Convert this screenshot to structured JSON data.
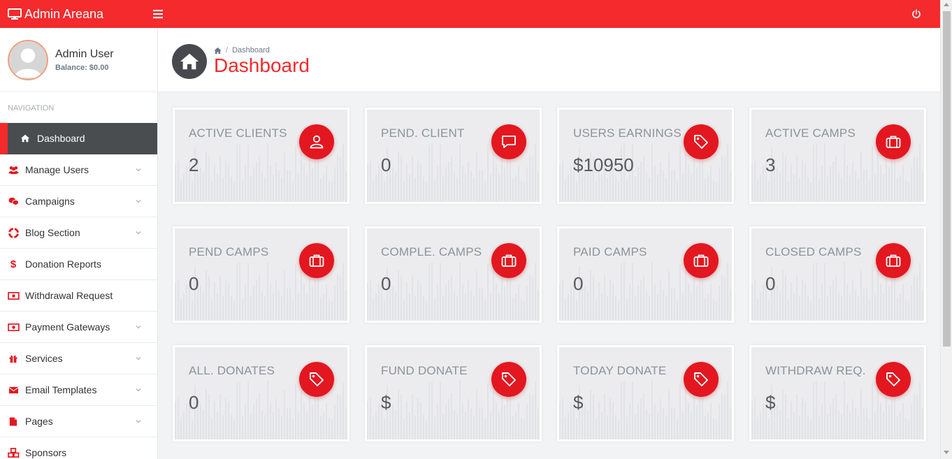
{
  "brand": {
    "title": "Admin Areana"
  },
  "user": {
    "name": "Admin User",
    "balance_label": "Balance:",
    "balance_value": "$0.00"
  },
  "sidebar": {
    "heading": "NAVIGATION",
    "items": [
      {
        "label": "Dashboard",
        "icon": "home-icon",
        "active": true,
        "has_chevron": false
      },
      {
        "label": "Manage Users",
        "icon": "users-icon",
        "has_chevron": true
      },
      {
        "label": "Campaigns",
        "icon": "campaigns-icon",
        "has_chevron": true
      },
      {
        "label": "Blog Section",
        "icon": "lifebuoy-icon",
        "has_chevron": true
      },
      {
        "label": "Donation Reports",
        "icon": "dollar-icon",
        "has_chevron": false
      },
      {
        "label": "Withdrawal Request",
        "icon": "money-icon",
        "has_chevron": false
      },
      {
        "label": "Payment Gateways",
        "icon": "money-icon",
        "has_chevron": true
      },
      {
        "label": "Services",
        "icon": "gift-icon",
        "has_chevron": true
      },
      {
        "label": "Email Templates",
        "icon": "envelope-icon",
        "has_chevron": true
      },
      {
        "label": "Pages",
        "icon": "file-icon",
        "has_chevron": true
      },
      {
        "label": "Sponsors",
        "icon": "cubes-icon",
        "has_chevron": false
      }
    ]
  },
  "header": {
    "breadcrumb": "Dashboard",
    "title": "Dashboard"
  },
  "cards": [
    {
      "label": "ACTIVE CLIENTS",
      "value": "2",
      "icon": "user-icon"
    },
    {
      "label": "PEND. CLIENT",
      "value": "0",
      "icon": "comment-icon"
    },
    {
      "label": "USERS EARNINGS",
      "value": "$10950",
      "icon": "tag-icon"
    },
    {
      "label": "ACTIVE CAMPS",
      "value": "3",
      "icon": "briefcase-icon"
    },
    {
      "label": "PEND CAMPS",
      "value": "0",
      "icon": "briefcase-icon"
    },
    {
      "label": "COMPLE. CAMPS",
      "value": "0",
      "icon": "briefcase-icon"
    },
    {
      "label": "PAID CAMPS",
      "value": "0",
      "icon": "briefcase-icon"
    },
    {
      "label": "CLOSED CAMPS",
      "value": "0",
      "icon": "briefcase-icon"
    },
    {
      "label": "ALL. DONATES",
      "value": "0",
      "icon": "tag-icon"
    },
    {
      "label": "FUND DONATE",
      "value": "$",
      "icon": "tag-icon"
    },
    {
      "label": "TODAY DONATE",
      "value": "$",
      "icon": "tag-icon"
    },
    {
      "label": "WITHDRAW REQ.",
      "value": "$",
      "icon": "tag-icon"
    }
  ],
  "colors": {
    "accent": "#f42a2c",
    "icon_bg": "#e3171f",
    "sidebar_active": "#4a4d50",
    "card_bg": "#ececee"
  }
}
